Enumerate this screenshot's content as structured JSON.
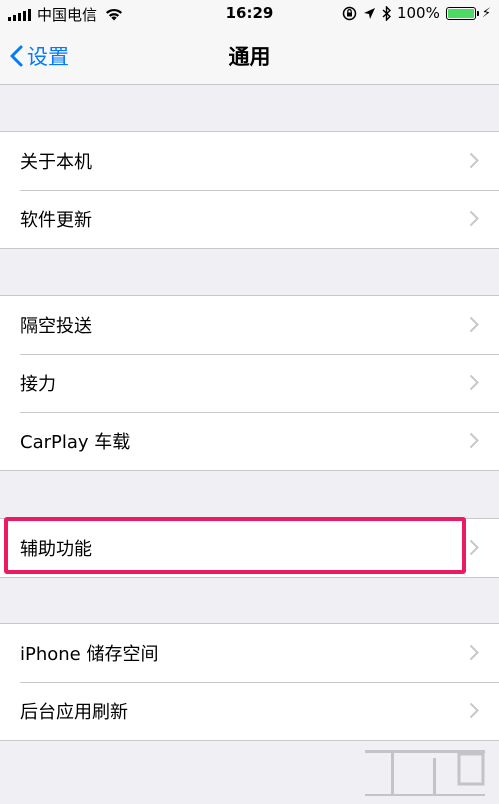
{
  "status_bar": {
    "carrier": "中国电信",
    "time": "16:29",
    "battery": "100%"
  },
  "nav": {
    "back_label": "设置",
    "title": "通用"
  },
  "groups": [
    {
      "items": [
        {
          "label": "关于本机"
        },
        {
          "label": "软件更新"
        }
      ]
    },
    {
      "items": [
        {
          "label": "隔空投送"
        },
        {
          "label": "接力"
        },
        {
          "label": "CarPlay 车载"
        }
      ]
    },
    {
      "items": [
        {
          "label": "辅助功能"
        }
      ]
    },
    {
      "items": [
        {
          "label": "iPhone 储存空间"
        },
        {
          "label": "后台应用刷新"
        }
      ]
    }
  ],
  "colors": {
    "accent": "#007aff",
    "highlight": "#ec1a62",
    "battery": "#4cd964",
    "background": "#efeff4"
  }
}
